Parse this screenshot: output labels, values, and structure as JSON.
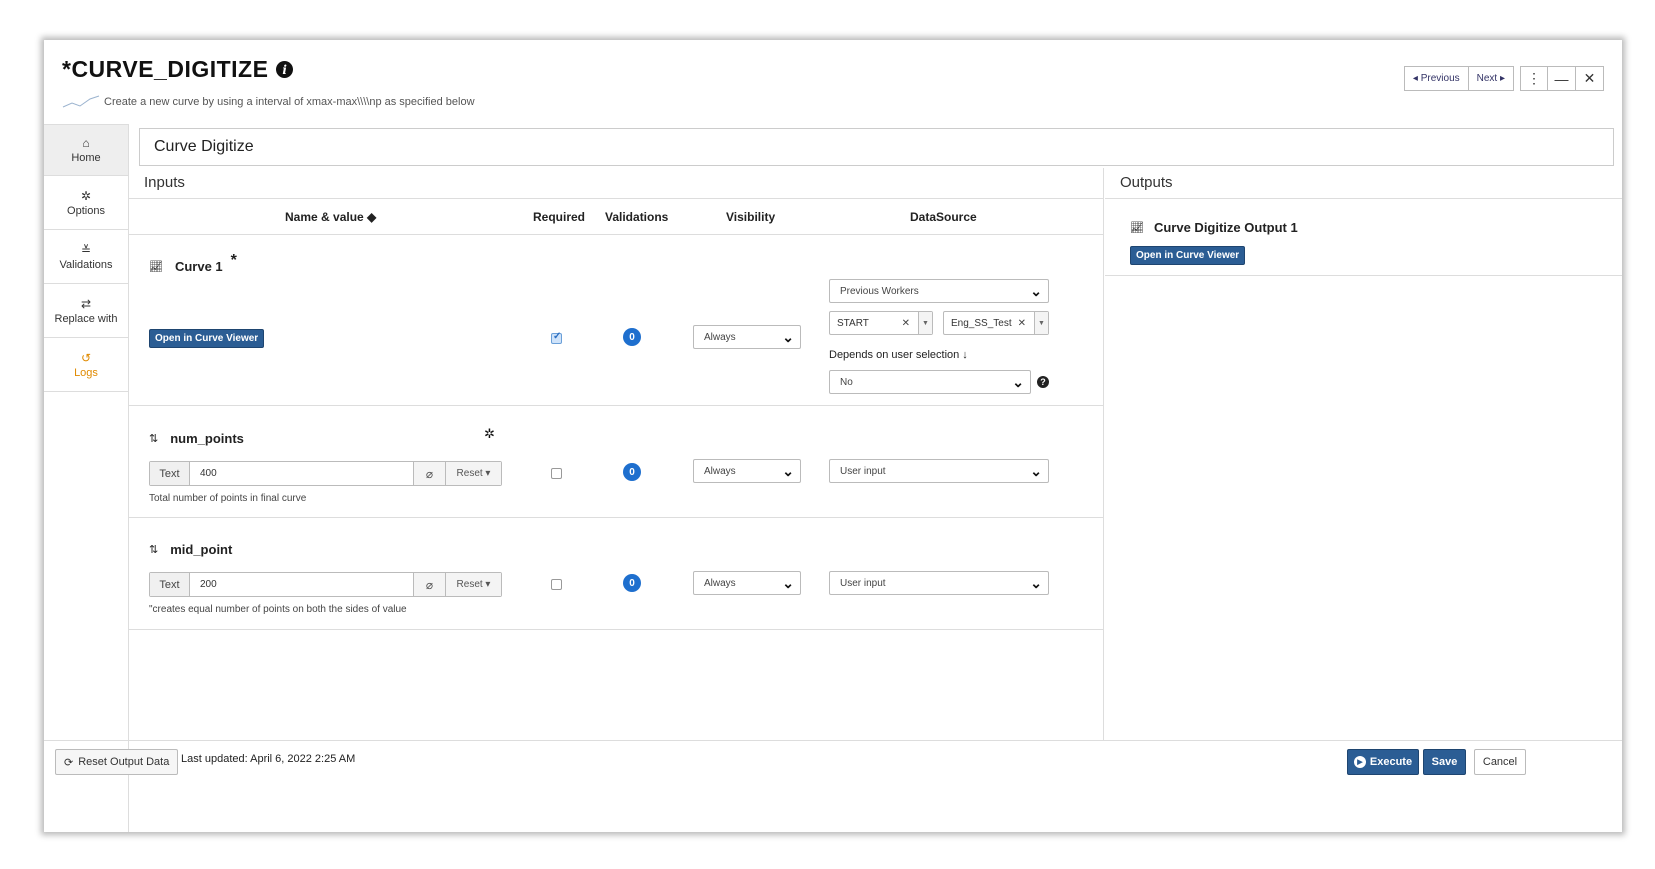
{
  "header": {
    "title": "*CURVE_DIGITIZE",
    "subtitle": "Create a new curve by using a interval of xmax-max\\\\\\\\np as specified below",
    "previous_label": "◂ Previous",
    "next_label": "Next ▸",
    "menu_icon": "⋮",
    "minimize_icon": "—",
    "close_icon": "✕"
  },
  "sidebar": {
    "items": [
      {
        "label": "Home",
        "icon": "home-icon"
      },
      {
        "label": "Options",
        "icon": "gear-icon"
      },
      {
        "label": "Validations",
        "icon": "chevrons-down-icon"
      },
      {
        "label": "Replace with",
        "icon": "swap-icon"
      },
      {
        "label": "Logs",
        "icon": "history-icon"
      }
    ]
  },
  "name_field": "Curve Digitize",
  "inputs": {
    "title": "Inputs",
    "columns": [
      "Name & value ◆",
      "Required",
      "Validations",
      "Visibility",
      "DataSource"
    ],
    "curve": {
      "name": "Curve 1",
      "required_mark": "*",
      "button": "Open in Curve Viewer",
      "required_checked": true,
      "validations": "0",
      "visibility": "Always",
      "datasource": "Previous Workers",
      "tag1": "START",
      "tag2": "Eng_SS_Test",
      "depends_label": "Depends on user selection ↓",
      "depends_value": "No"
    },
    "params": [
      {
        "name": "num_points",
        "type": "Text",
        "value": "400",
        "reset": "Reset ▾",
        "help": "Total number of points in final curve",
        "validations": "0",
        "visibility": "Always",
        "datasource": "User input"
      },
      {
        "name": "mid_point",
        "type": "Text",
        "value": "200",
        "reset": "Reset ▾",
        "help": "\"creates equal number of points on both the sides of value",
        "validations": "0",
        "visibility": "Always",
        "datasource": "User input"
      }
    ]
  },
  "outputs": {
    "title": "Outputs",
    "name": "Curve Digitize Output 1",
    "button": "Open in Curve Viewer"
  },
  "footer": {
    "reset_label": "Reset Output Data",
    "last_updated": "Last updated: April 6, 2022 2:25 AM",
    "execute_label": "Execute",
    "save_label": "Save",
    "cancel_label": "Cancel"
  }
}
